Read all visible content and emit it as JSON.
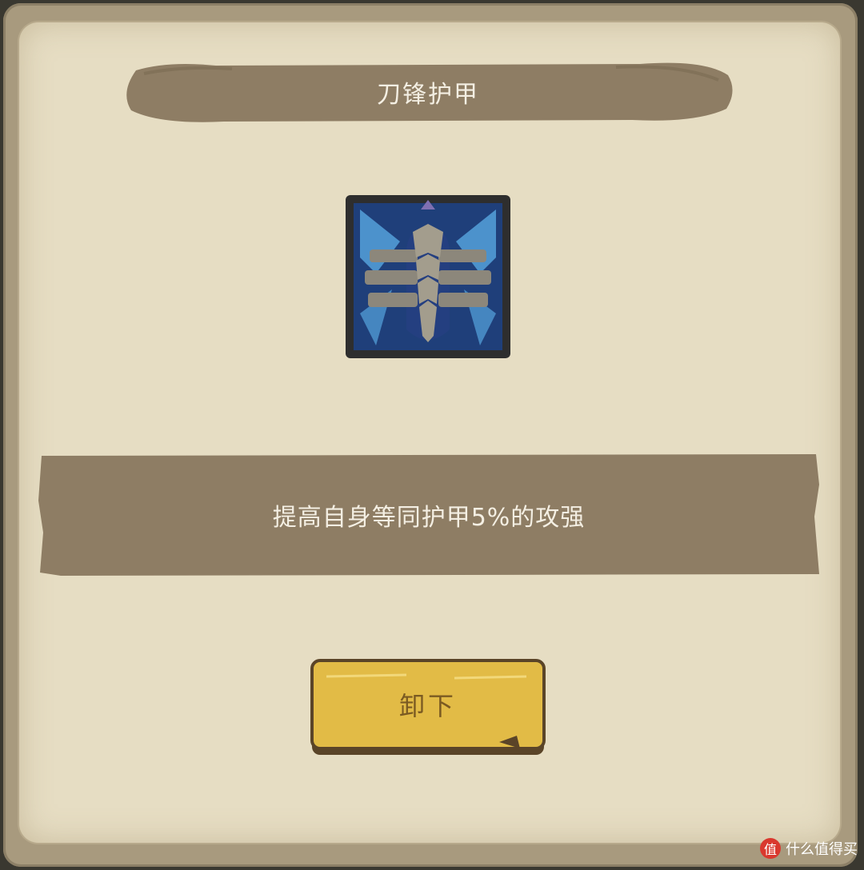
{
  "item": {
    "name": "刀锋护甲",
    "description": "提高自身等同护甲5%的攻强",
    "icon": "bladed-armor-icon"
  },
  "actions": {
    "unequip_label": "卸下"
  },
  "watermark": {
    "badge": "值",
    "text": "什么值得买"
  },
  "colors": {
    "paper": "#e6ddc3",
    "banner": "#8e7d64",
    "button": "#e2bb46",
    "text_light": "#f4efe3"
  }
}
